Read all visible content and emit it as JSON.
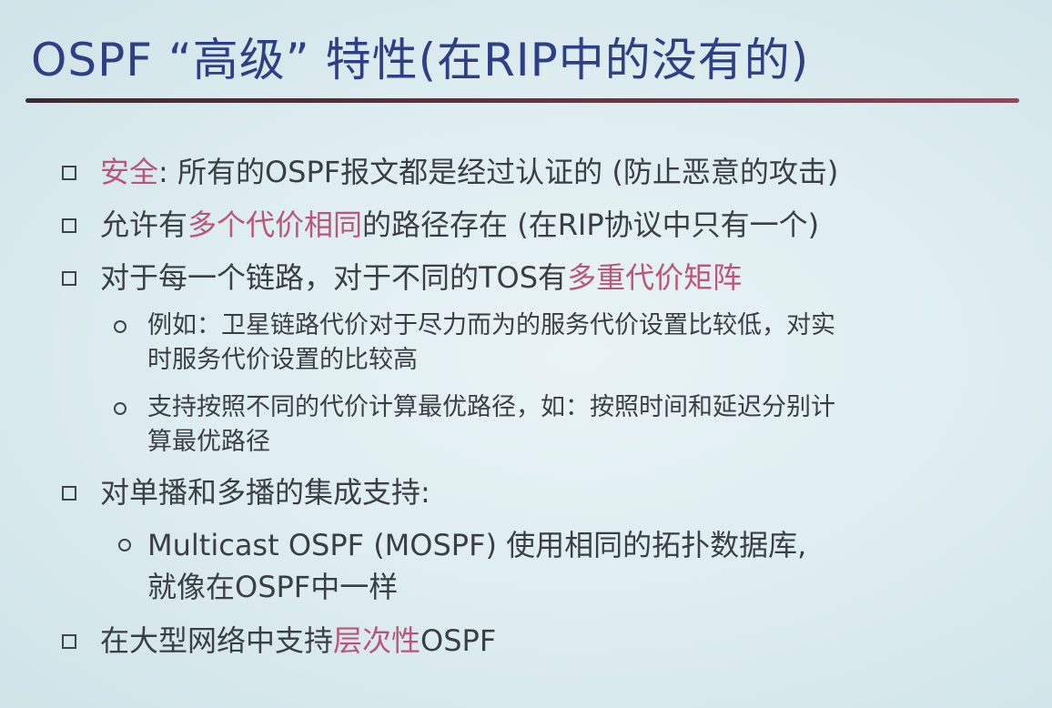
{
  "slide": {
    "title": "OSPF “高级” 特性(在RIP中的没有的)",
    "bullets": [
      {
        "hl": "安全",
        "rest": ": 所有的OSPF报文都是经过认证的 (防止恶意的攻击)"
      },
      {
        "pre": "允许有",
        "hl": "多个代价相同",
        "rest": "的路径存在 (在RIP协议中只有一个)"
      },
      {
        "pre": "对于每一个链路，对于不同的TOS有",
        "hl": "多重代价矩阵"
      },
      {
        "text": "对单播和多播的集成支持:"
      },
      {
        "pre": "在大型网络中支持",
        "hl": "层次性",
        "rest": "OSPF"
      }
    ],
    "subs": {
      "tos_1_line1": "例如：卫星链路代价对于尽力而为的服务代价设置比较低，对实",
      "tos_1_line2": "时服务代价设置的比较高",
      "tos_2_line1": "支持按照不同的代价计算最优路径，如：按照时间和延迟分别计",
      "tos_2_line2": "算最优路径",
      "mospf_line1": "Multicast OSPF (MOSPF) 使用相同的拓扑数据库,",
      "mospf_line2": "就像在OSPF中一样"
    },
    "colors": {
      "title": "#2f3f86",
      "highlight": "#b8577a",
      "body": "#3a3f44"
    }
  }
}
